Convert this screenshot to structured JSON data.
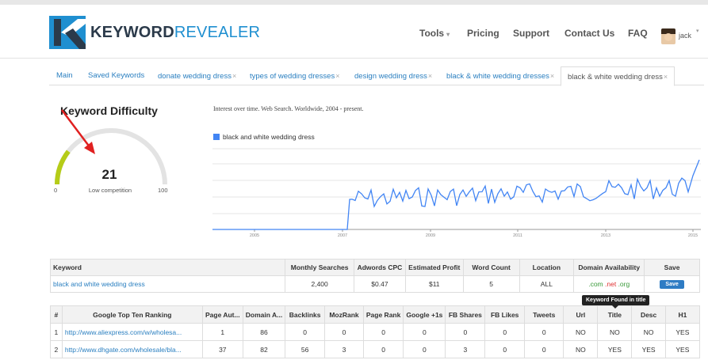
{
  "brand": {
    "bold": "KEYWORD",
    "light": "REVEALER"
  },
  "nav": {
    "tools": "Tools",
    "pricing": "Pricing",
    "support": "Support",
    "contact": "Contact Us",
    "faq": "FAQ"
  },
  "user": {
    "name": "jack"
  },
  "tabs": [
    {
      "label": "Main"
    },
    {
      "label": "Saved Keywords"
    },
    {
      "label": "donate wedding dress",
      "close": "×"
    },
    {
      "label": "types of wedding dresses",
      "close": "×"
    },
    {
      "label": "design wedding dress",
      "close": "×"
    },
    {
      "label": "black & white wedding dresses",
      "close": "×"
    },
    {
      "label": "black & white wedding dress",
      "close": "×"
    }
  ],
  "difficulty": {
    "title": "Keyword Difficulty",
    "value": "21",
    "label": "Low competition",
    "min": "0",
    "max": "100",
    "fill_fraction": 0.21,
    "fill_color": "#b5cc18",
    "track_color": "#e3e3e3"
  },
  "trend": {
    "caption": "Interest over time. Web Search. Worldwide, 2004 - present.",
    "legend": "black and white wedding dress",
    "color": "#4285f4",
    "x_ticks": [
      "2005",
      "2007",
      "2009",
      "2011",
      "2013",
      "2015"
    ]
  },
  "keyword_table": {
    "headers": [
      "Keyword",
      "Monthly Searches",
      "Adwords CPC",
      "Estimated Profit",
      "Word Count",
      "Location",
      "Domain Availability",
      "Save"
    ],
    "row": {
      "keyword": "black and white wedding dress",
      "monthly_searches": "2,400",
      "cpc": "$0.47",
      "profit": "$11",
      "word_count": "5",
      "location": "ALL",
      "domains": {
        "com": ".com",
        "net": ".net",
        "org": ".org"
      },
      "save": "Save"
    }
  },
  "tooltip": "Keyword Found in title",
  "rank_table": {
    "headers": [
      "#",
      "Google Top Ten Ranking",
      "Page Aut...",
      "Domain A...",
      "Backlinks",
      "MozRank",
      "Page Rank",
      "Google +1s",
      "FB Shares",
      "FB Likes",
      "Tweets",
      "Url",
      "Title",
      "Desc",
      "H1"
    ],
    "rows": [
      [
        "1",
        "http://www.aliexpress.com/w/wholesa...",
        "1",
        "86",
        "0",
        "0",
        "0",
        "0",
        "0",
        "0",
        "0",
        "NO",
        "NO",
        "NO",
        "YES"
      ],
      [
        "2",
        "http://www.dhgate.com/wholesale/bla...",
        "37",
        "82",
        "56",
        "3",
        "0",
        "0",
        "3",
        "0",
        "0",
        "NO",
        "YES",
        "YES",
        "YES"
      ]
    ]
  }
}
